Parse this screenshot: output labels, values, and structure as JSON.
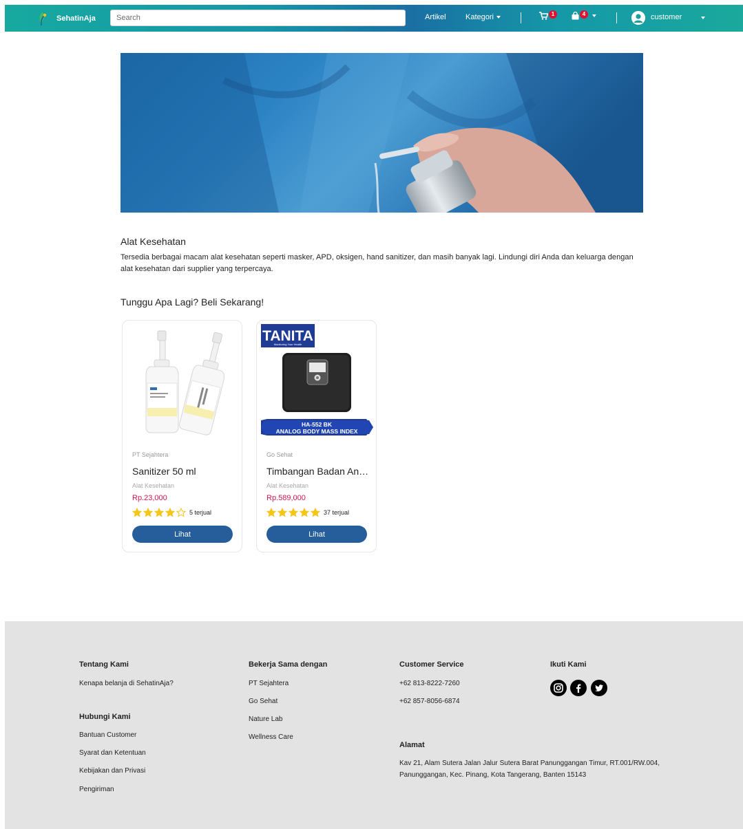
{
  "navbar": {
    "brand": "SehatinAja",
    "search_placeholder": "Search",
    "artikel": "Artikel",
    "kategori": "Kategori",
    "cart_count": "1",
    "bag_count": "4",
    "username": "customer"
  },
  "section": {
    "title": "Alat Kesehatan",
    "description": "Tersedia berbagai macam alat kesehatan seperti masker, APD, oksigen, hand sanitizer, dan masih banyak lagi. Lindungi diri Anda dan keluarga dengan alat kesehatan dari supplier yang terpercaya.",
    "cta": "Tunggu Apa Lagi? Beli Sekarang!"
  },
  "products": [
    {
      "supplier": "PT Sejahtera",
      "name": "Sanitizer 50 ml",
      "category": "Alat Kesehatan",
      "price": "Rp.23,000",
      "rating": 4,
      "sold": "5 terjual",
      "button": "Lihat"
    },
    {
      "supplier": "Go Sehat",
      "name": "Timbangan Badan Analog",
      "category": "Alat Kesehatan",
      "price": "Rp.589,000",
      "rating": 5,
      "sold": "37 terjual",
      "button": "Lihat",
      "image_text": {
        "brand": "TANITA",
        "tagline": "Monitoring Your Health",
        "model": "HA-552 BK",
        "desc": "ANALOG BODY MASS INDEX"
      }
    }
  ],
  "footer": {
    "about": {
      "heading": "Tentang Kami",
      "link": "Kenapa belanja di SehatinAja?"
    },
    "contact": {
      "heading": "Hubungi Kami",
      "links": [
        "Bantuan Customer",
        "Syarat dan Ketentuan",
        "Kebijakan dan Privasi",
        "Pengiriman"
      ]
    },
    "partners": {
      "heading": "Bekerja Sama dengan",
      "links": [
        "PT Sejahtera",
        "Go Sehat",
        "Nature Lab",
        "Wellness Care"
      ]
    },
    "cs": {
      "heading": "Customer Service",
      "phones": [
        "+62 813-8222-7260",
        "+62 857-8056-6874"
      ]
    },
    "address": {
      "heading": "Alamat",
      "text": "Kav 21, Alam Sutera Jalan Jalur Sutera Barat Panunggangan Timur, RT.001/RW.004, Panunggangan, Kec. Pinang, Kota Tangerang, Banten 15143"
    },
    "follow": {
      "heading": "Ikuti Kami",
      "icons": [
        "instagram-icon",
        "facebook-icon",
        "twitter-icon"
      ]
    }
  },
  "colors": {
    "primary_button": "#255e9b",
    "price": "#d6134c",
    "badge": "#e0102e",
    "star": "#f5c518"
  }
}
